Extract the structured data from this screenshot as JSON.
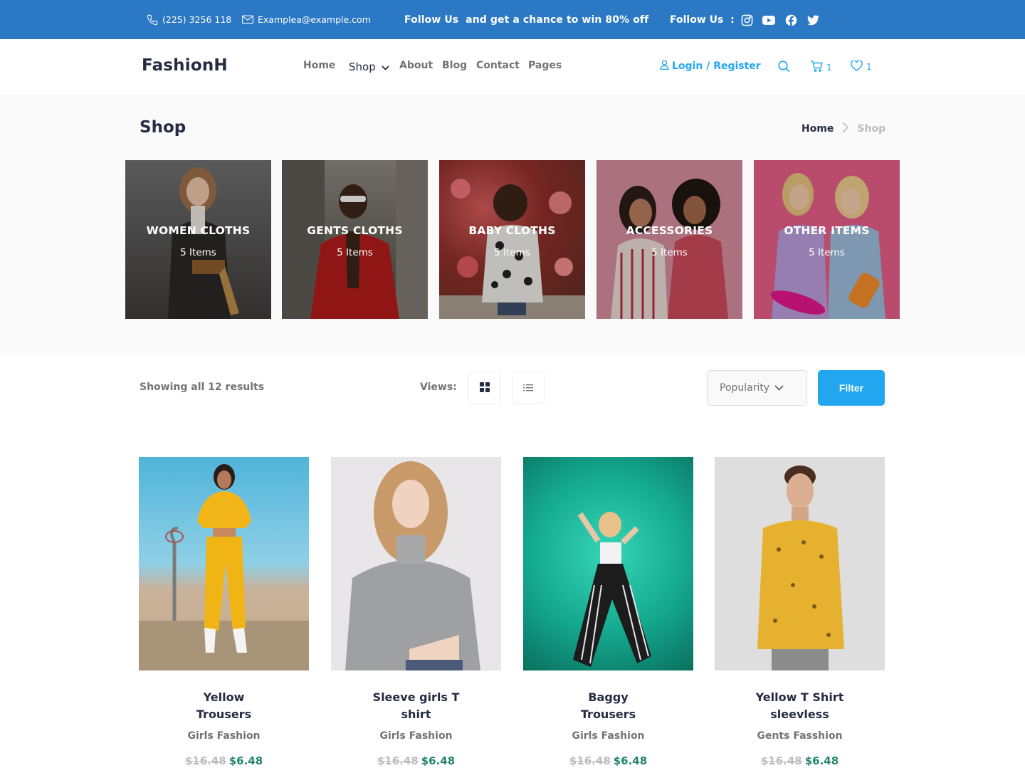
{
  "topbar": {
    "phone": "(225) 3256 118",
    "email": "Examplea@example.com",
    "promo": "Follow Us  and get a chance to win 80% off",
    "follow_label": "Follow Us  :",
    "social_icons": [
      "instagram-icon",
      "youtube-icon",
      "facebook-icon",
      "twitter-icon"
    ]
  },
  "nav": {
    "brand": "FashionH",
    "links": {
      "home": "Home",
      "shop": "Shop",
      "about": "About",
      "blog": "Blog",
      "contact": "Contact",
      "pages": "Pages"
    },
    "login": "Login / Register",
    "cart_count": "1",
    "wishlist_count": "1"
  },
  "shop": {
    "title": "Shop",
    "breadcrumb": {
      "home": "Home",
      "current": "Shop"
    }
  },
  "categories": [
    {
      "title": "WOMEN CLOTHS",
      "count": "5 Items"
    },
    {
      "title": "GENTS CLOTHS",
      "count": "5 Items"
    },
    {
      "title": "BABY CLOTHS",
      "count": "5 Items"
    },
    {
      "title": "ACCESSORIES",
      "count": "5 Items"
    },
    {
      "title": "OTHER ITEMS",
      "count": "5 Items"
    }
  ],
  "toolbar": {
    "showing": "Showing all 12 results",
    "views_label": "Views:",
    "sort_value": "Popularity",
    "filter_label": "Filter"
  },
  "products": [
    {
      "name": "Yellow Trousers",
      "category": "Girls Fashion",
      "old_price": "$16.48",
      "price": "$6.48"
    },
    {
      "name": "Sleeve girls T shirt",
      "category": "Girls Fashion",
      "old_price": "$16.48",
      "price": "$6.48"
    },
    {
      "name": "Baggy Trousers",
      "category": "Girls Fashion",
      "old_price": "$16.48",
      "price": "$6.48"
    },
    {
      "name": "Yellow T Shirt sleevless",
      "category": "Gents Fasshion",
      "old_price": "$16.48",
      "price": "$6.48"
    }
  ],
  "colors": {
    "topbar": "#2b78c4",
    "accent": "#23a6f0",
    "price": "#23856d",
    "muted": "#737373",
    "dark": "#252b42"
  }
}
